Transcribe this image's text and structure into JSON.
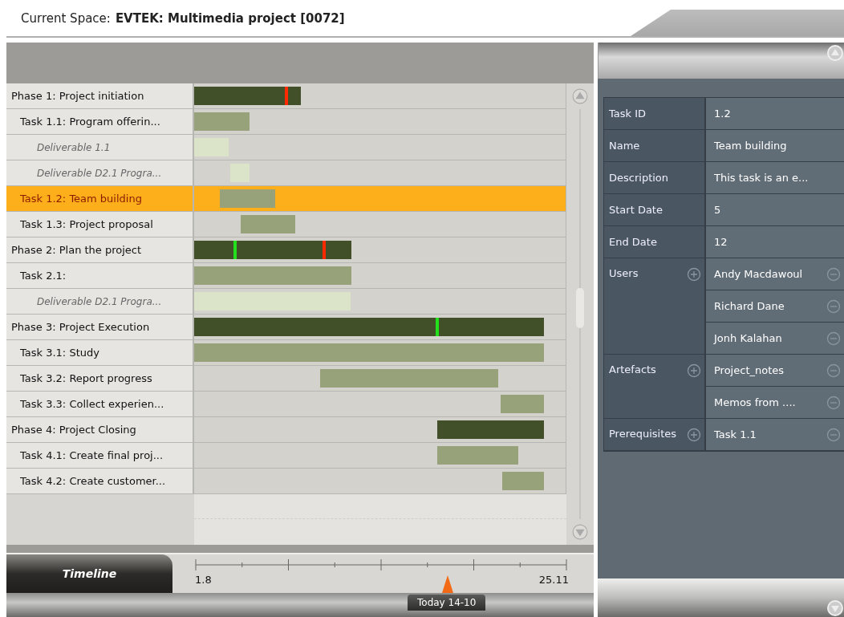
{
  "header": {
    "label": "Current Space:",
    "space": "EVTEK: Multimedia project [0072]"
  },
  "tasks": [
    {
      "kind": "phase",
      "label": "Phase 1:  Project initiation",
      "selected": false
    },
    {
      "kind": "task",
      "label": "Task 1.1: Program offerin...",
      "selected": false
    },
    {
      "kind": "deliverable",
      "label": "Deliverable 1.1",
      "selected": false
    },
    {
      "kind": "deliverable",
      "label": "Deliverable D2.1 Progra...",
      "selected": false
    },
    {
      "kind": "task",
      "label": "Task 1.2: Team building",
      "selected": true
    },
    {
      "kind": "task",
      "label": "Task 1.3: Project proposal",
      "selected": false
    },
    {
      "kind": "phase",
      "label": "Phase 2:  Plan the project",
      "selected": false
    },
    {
      "kind": "task",
      "label": "Task 2.1:",
      "selected": false
    },
    {
      "kind": "deliverable",
      "label": "Deliverable D2.1 Progra...",
      "selected": false
    },
    {
      "kind": "phase",
      "label": "Phase 3:  Project Execution",
      "selected": false
    },
    {
      "kind": "task",
      "label": "Task 3.1: Study",
      "selected": false
    },
    {
      "kind": "task",
      "label": "Task 3.2: Report progress",
      "selected": false
    },
    {
      "kind": "task",
      "label": "Task 3.3: Collect experien...",
      "selected": false
    },
    {
      "kind": "phase",
      "label": "Phase 4:  Project Closing",
      "selected": false
    },
    {
      "kind": "task",
      "label": "Task 4.1: Create final proj...",
      "selected": false
    },
    {
      "kind": "task",
      "label": "Task 4.2: Create customer...",
      "selected": false
    }
  ],
  "timeline": {
    "title": "Timeline",
    "start": "1.8",
    "end": "25.11",
    "today": "Today 14-10"
  },
  "details": [
    {
      "kind": "field",
      "label": "Task ID",
      "value": "1.2"
    },
    {
      "kind": "field",
      "label": "Name",
      "value": "Team building"
    },
    {
      "kind": "field",
      "label": "Description",
      "value": "This task is an e..."
    },
    {
      "kind": "field",
      "label": "Start Date",
      "value": "5"
    },
    {
      "kind": "field",
      "label": "End Date",
      "value": "12"
    },
    {
      "kind": "list",
      "label": "Users",
      "values": [
        "Andy Macdawoul",
        "Richard Dane",
        "Jonh Kalahan"
      ]
    },
    {
      "kind": "list",
      "label": "Artefacts",
      "values": [
        "Project_notes",
        "Memos from ...."
      ]
    },
    {
      "kind": "list",
      "label": "Prerequisites",
      "values": [
        "Task 1.1"
      ]
    }
  ]
}
